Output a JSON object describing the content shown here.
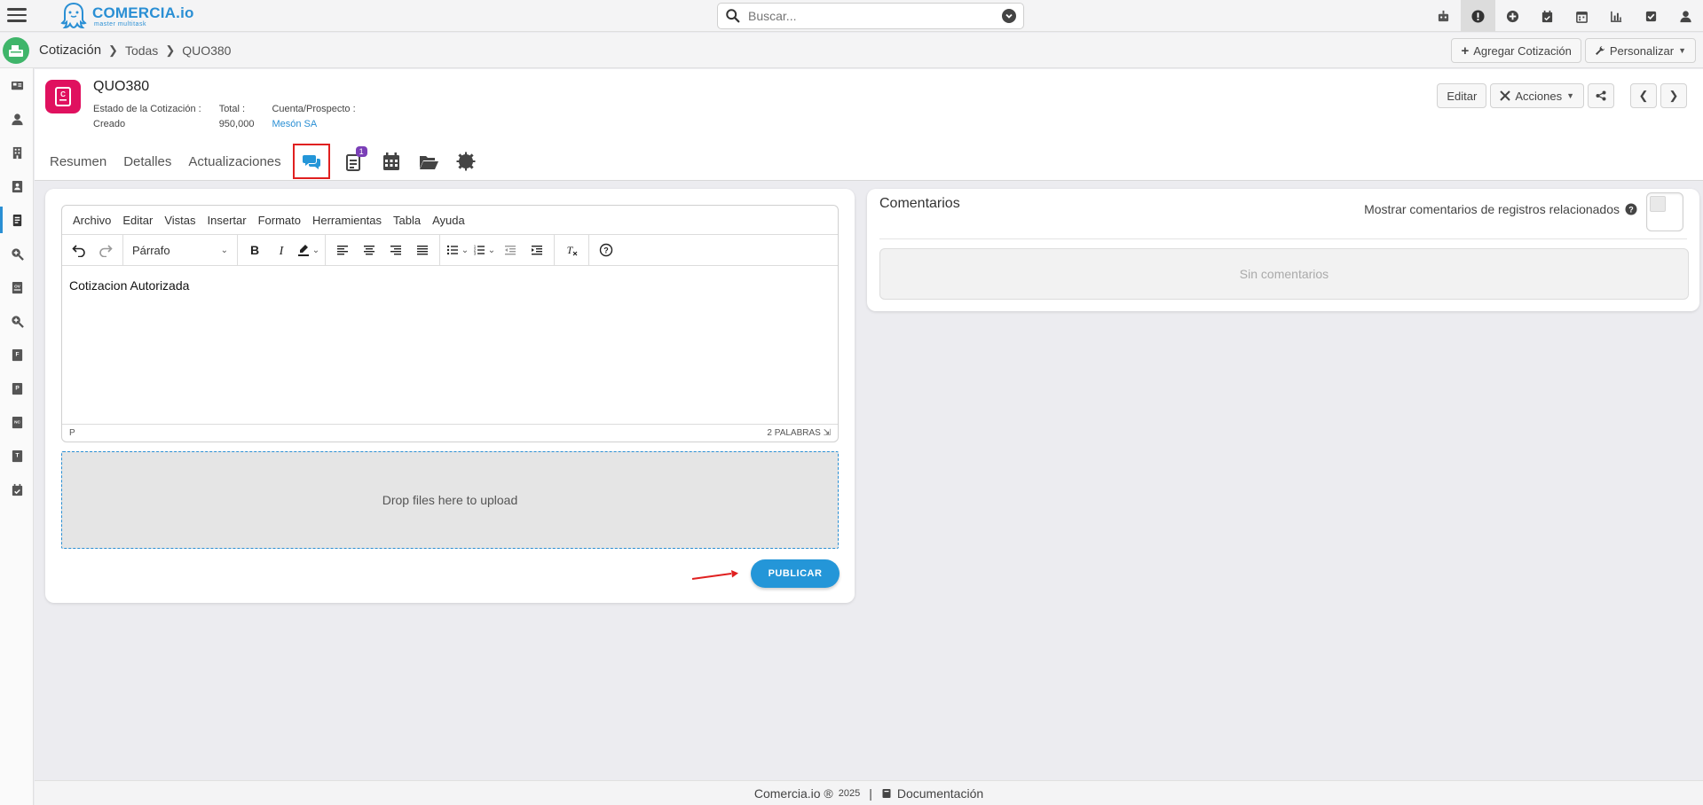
{
  "search": {
    "placeholder": "Buscar..."
  },
  "logo": {
    "name": "COMERCIA.io",
    "tagline": "master multitask"
  },
  "top_icons": [
    "robot-icon",
    "alert-icon",
    "plus-circle-icon",
    "calendar-check-icon",
    "calendar-icon",
    "chart-icon",
    "check-square-icon",
    "user-icon"
  ],
  "breadcrumb": {
    "module": "Cotización",
    "list": "Todas",
    "record": "QUO380"
  },
  "header_buttons": {
    "add": "Agregar Cotización",
    "customize": "Personalizar"
  },
  "record": {
    "title": "QUO380",
    "fields": {
      "status_label": "Estado de la Cotización :",
      "status_value": "Creado",
      "total_label": "Total :",
      "total_value": "950,000",
      "account_label": "Cuenta/Prospecto :",
      "account_value": "Mesón SA"
    },
    "actions": {
      "edit": "Editar",
      "actions": "Acciones"
    }
  },
  "tabs": {
    "summary": "Resumen",
    "details": "Detalles",
    "updates": "Actualizaciones",
    "badge_count": "1"
  },
  "editor": {
    "menu": [
      "Archivo",
      "Editar",
      "Vistas",
      "Insertar",
      "Formato",
      "Herramientas",
      "Tabla",
      "Ayuda"
    ],
    "block_format": "Párrafo",
    "content": "Cotizacion Autorizada",
    "status_path": "P",
    "word_count": "2 PALABRAS"
  },
  "dropzone": {
    "text": "Drop files here to upload"
  },
  "publish": {
    "label": "PUBLICAR"
  },
  "comments": {
    "title": "Comentarios",
    "toggle_label": "Mostrar comentarios de registros relacionados",
    "empty": "Sin comentarios"
  },
  "footer": {
    "brand": "Comercia.io ®",
    "year": "2025",
    "separator": "|",
    "docs": "Documentación"
  },
  "colors": {
    "accent": "#2496d8",
    "record_icon": "#e0115f",
    "highlight": "#e02020",
    "badge": "#7b3fb7",
    "home": "#3fb56a"
  }
}
